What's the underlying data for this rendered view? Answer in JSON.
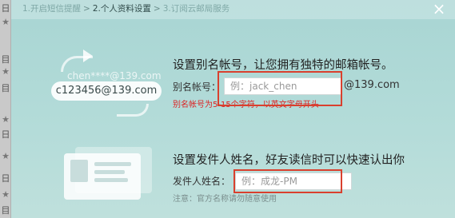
{
  "left_strip": {
    "marks": [
      "日",
      "目",
      "目",
      "日",
      "日",
      "目",
      "日"
    ]
  },
  "steps": [
    {
      "label": "1.开启短信提醒",
      "active": false
    },
    {
      "label": "2.个人资料设置",
      "active": true
    },
    {
      "label": "3.订阅云邮局服务",
      "active": false
    }
  ],
  "steps_separator": ">",
  "close_icon": "×",
  "illustration_1": {
    "faded_email": "chen****@139.com",
    "email_pill": "c123456@139.com"
  },
  "alias_section": {
    "title": "设置别名帐号，让您拥有独特的邮箱帐号。",
    "label": "别名帐号：",
    "placeholder": "例：jack_chen",
    "suffix": "@139.com",
    "hint": "别名帐号为5-15个字符，以英文字母开头"
  },
  "sender_section": {
    "title": "设置发件人姓名，好友读信时可以快速认出你",
    "label": "发件人姓名：",
    "placeholder": "例：成龙-PM",
    "hint": "注意：官方名称请勿随意使用"
  },
  "colors": {
    "highlight": "#d9402e",
    "hint_red": "#dd2222",
    "background": "#a8d5d3"
  }
}
